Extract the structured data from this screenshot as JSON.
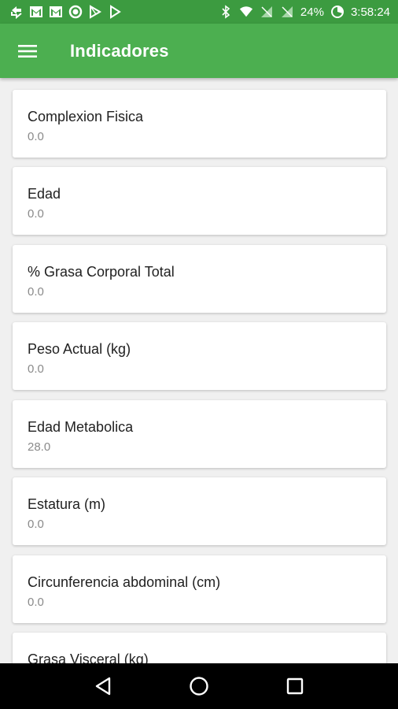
{
  "status_bar": {
    "battery": "24%",
    "time": "3:58:24",
    "left_icons": [
      "sync-icon",
      "gmail-icon",
      "gmail-icon",
      "circle-notification-icon",
      "play-store-icon",
      "play-icon"
    ],
    "right_icons": [
      "bluetooth-icon",
      "wifi-icon",
      "no-signal-icon",
      "no-signal-icon",
      "battery-saver-icon"
    ]
  },
  "app_bar": {
    "title": "Indicadores",
    "background": "#4caf50"
  },
  "cards": [
    {
      "label": "Complexion Fisica",
      "value": "0.0"
    },
    {
      "label": "Edad",
      "value": "0.0"
    },
    {
      "label": "% Grasa Corporal Total",
      "value": "0.0"
    },
    {
      "label": "Peso Actual (kg)",
      "value": "0.0"
    },
    {
      "label": "Edad Metabolica",
      "value": "28.0"
    },
    {
      "label": "Estatura (m)",
      "value": "0.0"
    },
    {
      "label": "Circunferencia abdominal (cm)",
      "value": "0.0"
    },
    {
      "label": "Grasa Visceral (kg)",
      "value": ""
    }
  ],
  "nav_bar": {
    "icons": [
      "back-icon",
      "home-icon",
      "recents-icon"
    ]
  }
}
